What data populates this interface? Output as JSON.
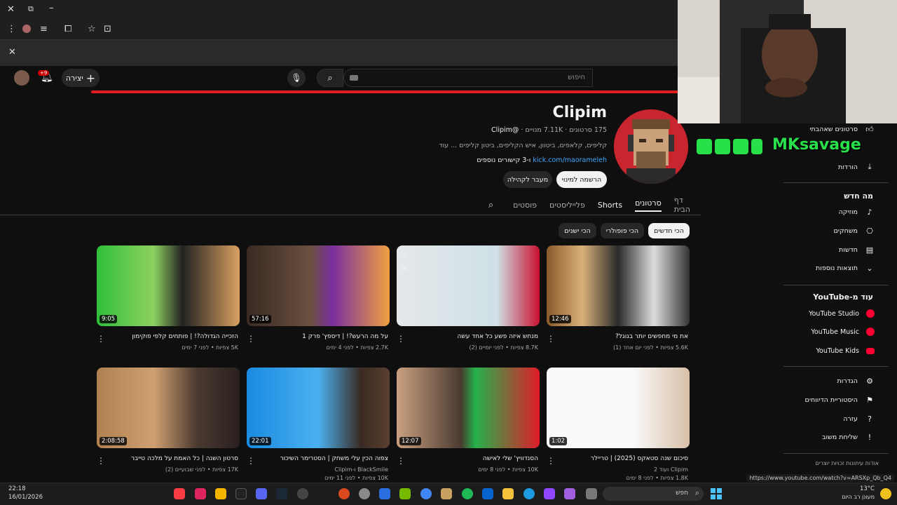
{
  "browser": {
    "icons": [
      "close-icon",
      "restore-icon",
      "minimize-icon",
      "menu-icon",
      "profile-icon",
      "list-icon",
      "extensions-icon",
      "star-icon",
      "screenshot-icon"
    ],
    "close_bar_icon": "x"
  },
  "header": {
    "search_placeholder": "חיפוש",
    "create_label": "יצירה",
    "notification_badge": "+9"
  },
  "channel": {
    "name": "Clipim",
    "handle": "@Clipim",
    "subscribers": "7.11K מנויים",
    "video_count": "175 סרטונים",
    "description": "קליפים, קלאפים, ביטוון, איש הקליפים, ביטון קליפים ... עוד",
    "link": "kick.com/maorameleh",
    "more_links": "ו-3 קישורים נוספים",
    "subscribe_label": "הרשמה למינוי",
    "community_label": "מעבר לקהילה"
  },
  "tabs": [
    "דף הבית",
    "סרטונים",
    "Shorts",
    "פלייליסטים",
    "פוסטים"
  ],
  "chips": [
    "הכי חדשים",
    "הכי פופולרי",
    "הכי ישנים"
  ],
  "videos": [
    {
      "title": "את מי מחפשים יותר בגוגל?",
      "meta": "5.6K צפיות • לפני יום אחד (1)",
      "duration": "12:46"
    },
    {
      "title": "מנחש איזה פשע כל אחד עשה",
      "meta": "8.7K צפיות • לפני יומיים (2)",
      "duration": ""
    },
    {
      "title": "על מה הרעש?! | דיספץ' פרק 1",
      "meta": "2.7K צפיות • לפני 4 ימים",
      "duration": "57:16"
    },
    {
      "title": "הזכייה הגדולה?! | פותחים קלפי פוקימון",
      "meta": "5K צפיות • לפני 7 ימים",
      "duration": "9:05"
    },
    {
      "title": "סיכום שנה סטאקס (2025) | טריילר",
      "meta": "Clipim ועוד 2",
      "meta2": "1.8K צפיות • לפני 8 ימים",
      "duration": "1:02"
    },
    {
      "title": "הסנדוויץ' שלי לאישה",
      "meta": "10K צפיות • לפני 8 ימים",
      "duration": "12:07"
    },
    {
      "title": "צפוה הכין עלי משחק | הסטרימר השיכור",
      "meta": "BlackSmile ו-Clipim",
      "meta2": "10K צפיות • לפני 11 ימים",
      "duration": "22:01"
    },
    {
      "title": "סרטון השנה | כל האמת על מלכה טייבר",
      "meta": "17K צפיות • לפני שבועיים (2)",
      "duration": "2:08:58"
    }
  ],
  "sidebar": {
    "top_items": [
      {
        "label": "סרטונים שאהבתי",
        "icon": "thumbs-up-icon"
      },
      {
        "label": "הורדות",
        "icon": "download-icon"
      }
    ],
    "whats_new_title": "מה חדש",
    "whats_new": [
      {
        "label": "מוזיקה",
        "icon": "music-icon"
      },
      {
        "label": "משחקים",
        "icon": "gamepad-icon"
      },
      {
        "label": "חדשות",
        "icon": "news-icon"
      },
      {
        "label": "תוצאות נוספות",
        "icon": "chevron-down-icon"
      }
    ],
    "more_from_title": "עוד מ-YouTube",
    "more_from": [
      "YouTube Studio",
      "YouTube Music",
      "YouTube Kids"
    ],
    "settings": [
      {
        "label": "הגדרות",
        "icon": "gear-icon"
      },
      {
        "label": "היסטוריית הדיווחים",
        "icon": "flag-icon"
      },
      {
        "label": "עזרה",
        "icon": "help-icon"
      },
      {
        "label": "שליחת משוב",
        "icon": "feedback-icon"
      }
    ],
    "footer": "אודות  עיתונות  זכויות יוצרים"
  },
  "overlay": {
    "streamer_name": "MKsavage"
  },
  "status_url": "https://www.youtube.com/watch?v=ARSXp_Qb_Q4",
  "taskbar": {
    "time": "22:18",
    "date": "16/01/2026",
    "search_placeholder": "חפש",
    "weather_temp": "13°C",
    "weather_desc": "מעונן רב היום"
  },
  "colors": {
    "background": "#0f0f0f",
    "accent_red": "#e41e1e",
    "link_blue": "#3ea6ff",
    "overlay_green": "#27e04a"
  }
}
